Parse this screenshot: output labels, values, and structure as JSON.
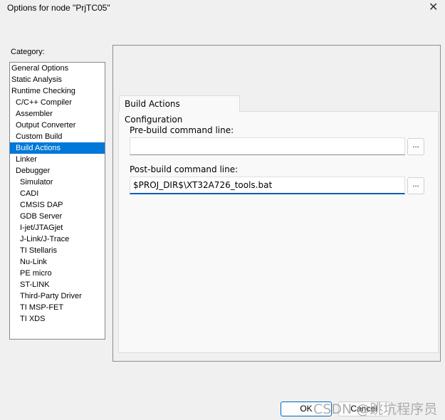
{
  "window": {
    "title": "Options for node \"PrjTC05\"",
    "close_icon": "close-icon"
  },
  "category": {
    "label": "Category:",
    "items": [
      {
        "label": "General Options",
        "level": 0
      },
      {
        "label": "Static Analysis",
        "level": 0
      },
      {
        "label": "Runtime Checking",
        "level": 0
      },
      {
        "label": "C/C++ Compiler",
        "level": 1
      },
      {
        "label": "Assembler",
        "level": 1
      },
      {
        "label": "Output Converter",
        "level": 1
      },
      {
        "label": "Custom Build",
        "level": 1
      },
      {
        "label": "Build Actions",
        "level": 1,
        "selected": true
      },
      {
        "label": "Linker",
        "level": 1
      },
      {
        "label": "Debugger",
        "level": 1
      },
      {
        "label": "Simulator",
        "level": 2
      },
      {
        "label": "CADI",
        "level": 2
      },
      {
        "label": "CMSIS DAP",
        "level": 2
      },
      {
        "label": "GDB Server",
        "level": 2
      },
      {
        "label": "I-jet/JTAGjet",
        "level": 2
      },
      {
        "label": "J-Link/J-Trace",
        "level": 2
      },
      {
        "label": "TI Stellaris",
        "level": 2
      },
      {
        "label": "Nu-Link",
        "level": 2
      },
      {
        "label": "PE micro",
        "level": 2
      },
      {
        "label": "ST-LINK",
        "level": 2
      },
      {
        "label": "Third-Party Driver",
        "level": 2
      },
      {
        "label": "TI MSP-FET",
        "level": 2
      },
      {
        "label": "TI XDS",
        "level": 2
      }
    ]
  },
  "tab": {
    "label": "Build Actions Configuration"
  },
  "prebuild": {
    "label": "Pre-build command line:",
    "value": "",
    "browse": "..."
  },
  "postbuild": {
    "label": "Post-build command line:",
    "value": "$PROJ_DIR$\\XT32A726_tools.bat",
    "browse": "..."
  },
  "buttons": {
    "ok": "OK",
    "cancel": "Cancel"
  },
  "watermark": "CSDN @跳坑程序员",
  "colors": {
    "selection": "#0078d7",
    "focus_underline": "#005fb8"
  }
}
